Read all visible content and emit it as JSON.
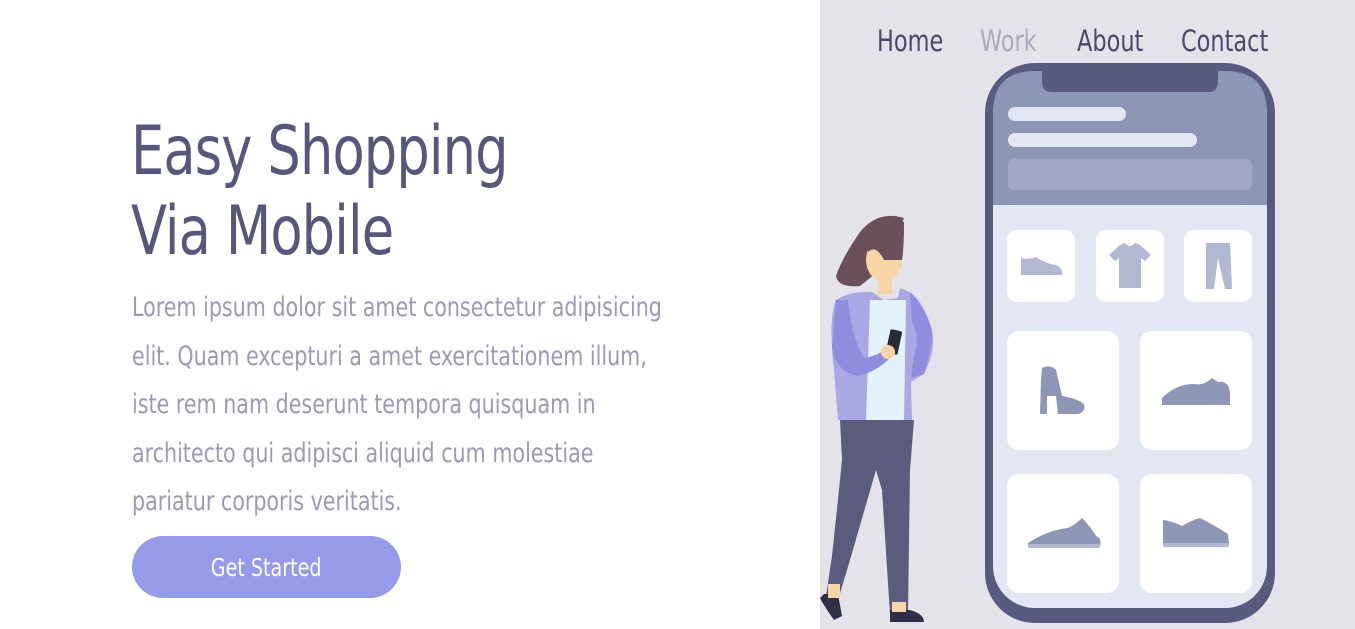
{
  "nav": {
    "items": [
      {
        "label": "Home",
        "active": false
      },
      {
        "label": "Work",
        "active": true
      },
      {
        "label": "About",
        "active": false
      },
      {
        "label": "Contact",
        "active": false
      }
    ]
  },
  "hero": {
    "title_line1": "Easy Shopping",
    "title_line2": "Via Mobile",
    "description": "Lorem ipsum dolor sit amet consectetur adipisicing elit. Quam excepturi a amet exercitationem illum, iste rem nam deserunt tempora quisquam in architecto qui adipisci aliquid cum molestiae pariatur corporis veritatis.",
    "cta_label": "Get Started"
  },
  "illustration": {
    "icons": [
      "flat-shoe-icon",
      "t-shirt-icon",
      "pants-icon",
      "boot-icon",
      "sneaker-icon",
      "sneaker-icon",
      "sneaker-icon"
    ]
  },
  "colors": {
    "primary_text": "#56577a",
    "body_text": "#9a9bb1",
    "button": "#969be9",
    "panel_bg": "#e4e3ea",
    "phone_frame": "#595a7f"
  }
}
